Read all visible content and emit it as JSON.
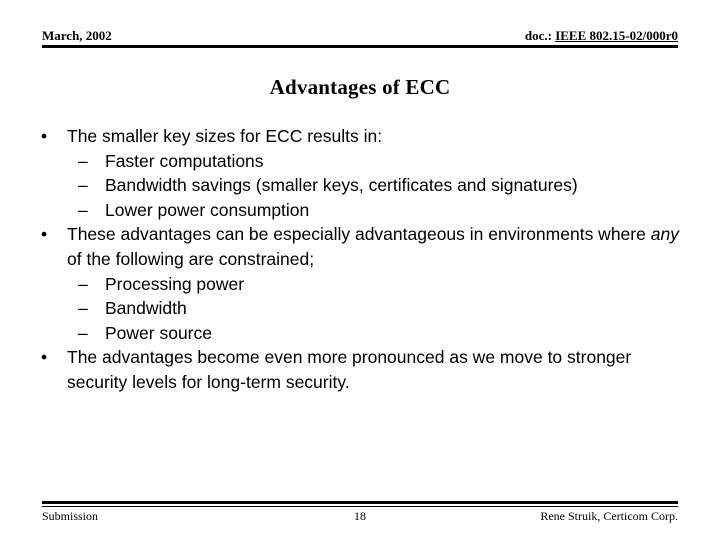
{
  "slide": {
    "header": {
      "left_text": "March, 2002",
      "doc_label": "doc.: ",
      "doc_number": "IEEE 802.15-02/000r0"
    },
    "title": "Advantages of ECC",
    "bullets": [
      {
        "level": 1,
        "marker": "•",
        "text": "The smaller key sizes for ECC results in:"
      },
      {
        "level": 2,
        "marker": "–",
        "text": "Faster computations"
      },
      {
        "level": 2,
        "marker": "–",
        "text": "Bandwidth savings (smaller keys, certificates and signatures)"
      },
      {
        "level": 2,
        "marker": "–",
        "text": "Lower power consumption"
      },
      {
        "level": 1,
        "marker": "•",
        "text_before_italic": "These advantages can be especially advantageous in environments where ",
        "italic_word": "any",
        "text_after_italic": " of the following are constrained;"
      },
      {
        "level": 2,
        "marker": "–",
        "text": "Processing power"
      },
      {
        "level": 2,
        "marker": "–",
        "text": "Bandwidth"
      },
      {
        "level": 2,
        "marker": "–",
        "text": "Power source"
      },
      {
        "level": 1,
        "marker": "•",
        "text": "The advantages become even more pronounced as we move to stronger security levels for long-term security."
      }
    ],
    "footer": {
      "left_text": "Submission",
      "page_number": "18",
      "right_text": "Rene Struik, Certicom Corp."
    },
    "colors": {
      "background": "#ffffff",
      "text": "#000000",
      "rule": "#000000"
    }
  }
}
